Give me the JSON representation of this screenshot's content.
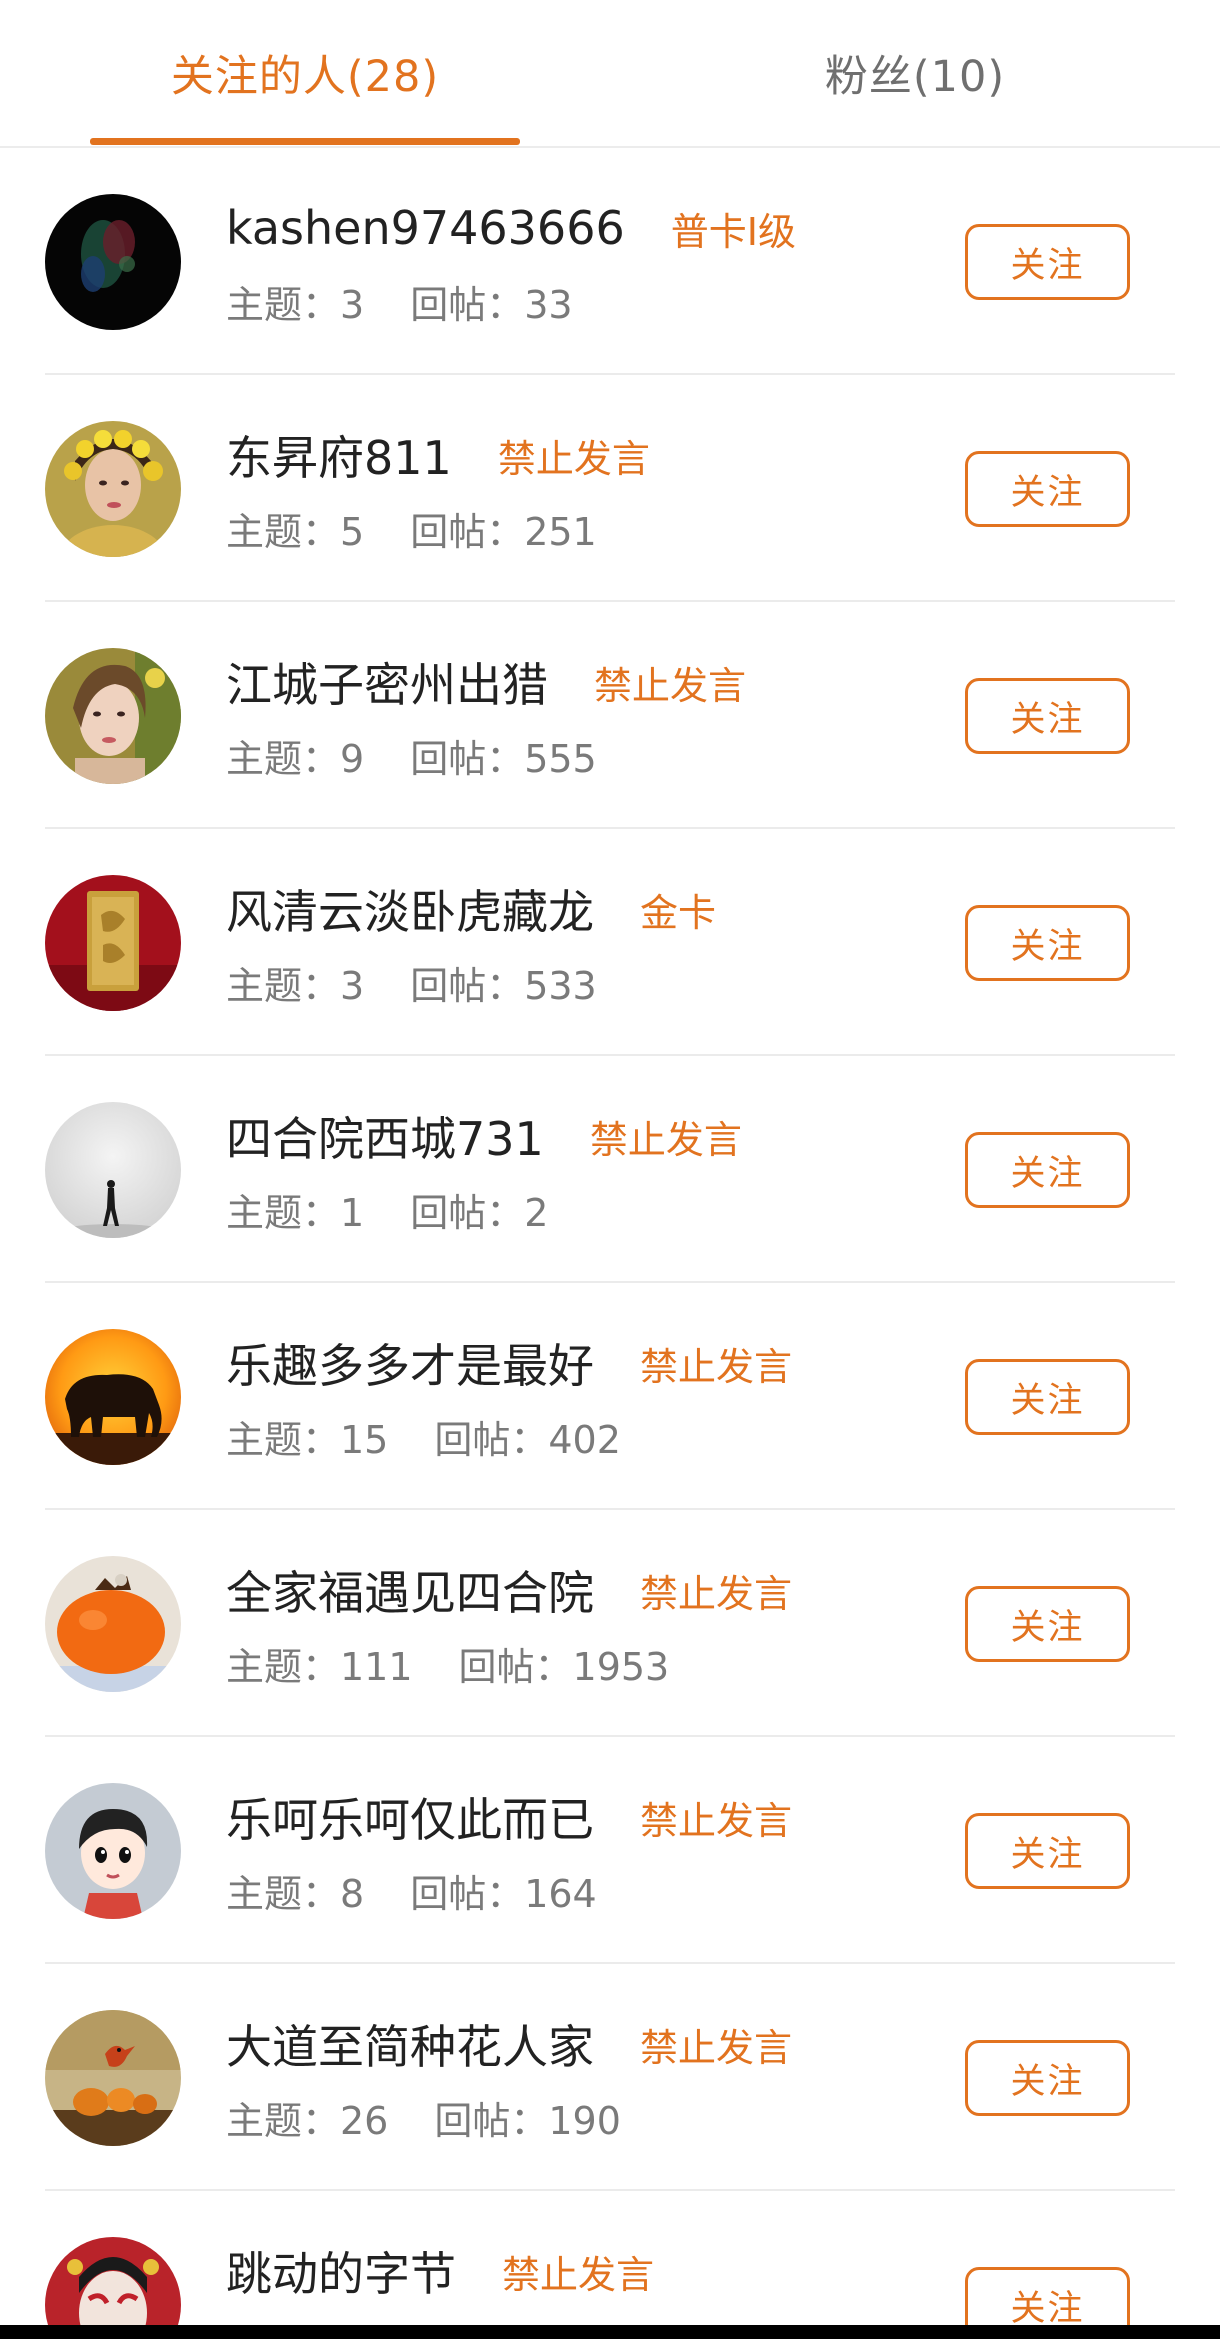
{
  "tabs": {
    "following_label": "关注的人(28)",
    "fans_label": "粉丝(10)"
  },
  "colors": {
    "accent": "#e2731f",
    "text_primary": "#222222",
    "text_secondary": "#7a7a7a",
    "divider": "#ebebeb"
  },
  "follow_button_label": "关注",
  "users": [
    {
      "name": "kashen97463666",
      "badge": "普卡I级",
      "topics": "主题：3",
      "replies": "回帖：33",
      "avatar": "dark-abstract-avatar"
    },
    {
      "name": "东昇府811",
      "badge": "禁止发言",
      "topics": "主题：5",
      "replies": "回帖：251",
      "avatar": "woman-flower-crown-avatar"
    },
    {
      "name": "江城子密州出猎",
      "badge": "禁止发言",
      "topics": "主题：9",
      "replies": "回帖：555",
      "avatar": "woman-portrait-avatar"
    },
    {
      "name": "风清云淡卧虎藏龙",
      "badge": "金卡",
      "topics": "主题：3",
      "replies": "回帖：533",
      "avatar": "gold-bar-avatar"
    },
    {
      "name": "四合院西城731",
      "badge": "禁止发言",
      "topics": "主题：1",
      "replies": "回帖：2",
      "avatar": "walking-figure-avatar"
    },
    {
      "name": "乐趣多多才是最好",
      "badge": "禁止发言",
      "topics": "主题：15",
      "replies": "回帖：402",
      "avatar": "elephant-sunset-avatar"
    },
    {
      "name": "全家福遇见四合院",
      "badge": "禁止发言",
      "topics": "主题：111",
      "replies": "回帖：1953",
      "avatar": "persimmon-avatar"
    },
    {
      "name": "乐呵乐呵仅此而已",
      "badge": "禁止发言",
      "topics": "主题：8",
      "replies": "回帖：164",
      "avatar": "cartoon-boy-avatar"
    },
    {
      "name": "大道至简种花人家",
      "badge": "禁止发言",
      "topics": "主题：26",
      "replies": "回帖：190",
      "avatar": "pumpkins-bird-avatar"
    },
    {
      "name": "跳动的字节",
      "badge": "禁止发言",
      "topics": "",
      "replies": "",
      "avatar": "opera-mask-avatar"
    }
  ]
}
